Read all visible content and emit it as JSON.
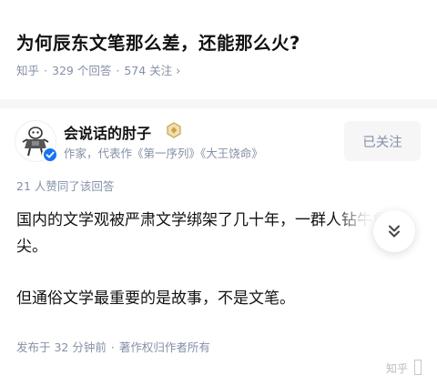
{
  "question": {
    "title": "为何辰东文笔那么差，还能那么火?",
    "source": "知乎",
    "answer_count": "329 个回答",
    "follower_count": "574 关注",
    "chevron_icon": "chevron-right-icon"
  },
  "author": {
    "name": "会说话的肘子",
    "description": "作家，代表作《第一序列》《大王饶命》",
    "follow_label": "已关注",
    "badge_color": "#c9a24a",
    "verified_color": "#1772f6"
  },
  "answer": {
    "upvote_text": "21 人赞同了该回答",
    "paragraph_1": "国内的文学观被严肃文学绑架了几十年，一群人钻牛角尖。",
    "paragraph_2": "但通俗文学最重要的是故事，不是文笔。",
    "posted_time": "发布于 32 分钟前",
    "copyright": "著作权归作者所有",
    "expand_icon": "double-chevron-down-icon"
  },
  "watermark": {
    "text": "知乎"
  }
}
